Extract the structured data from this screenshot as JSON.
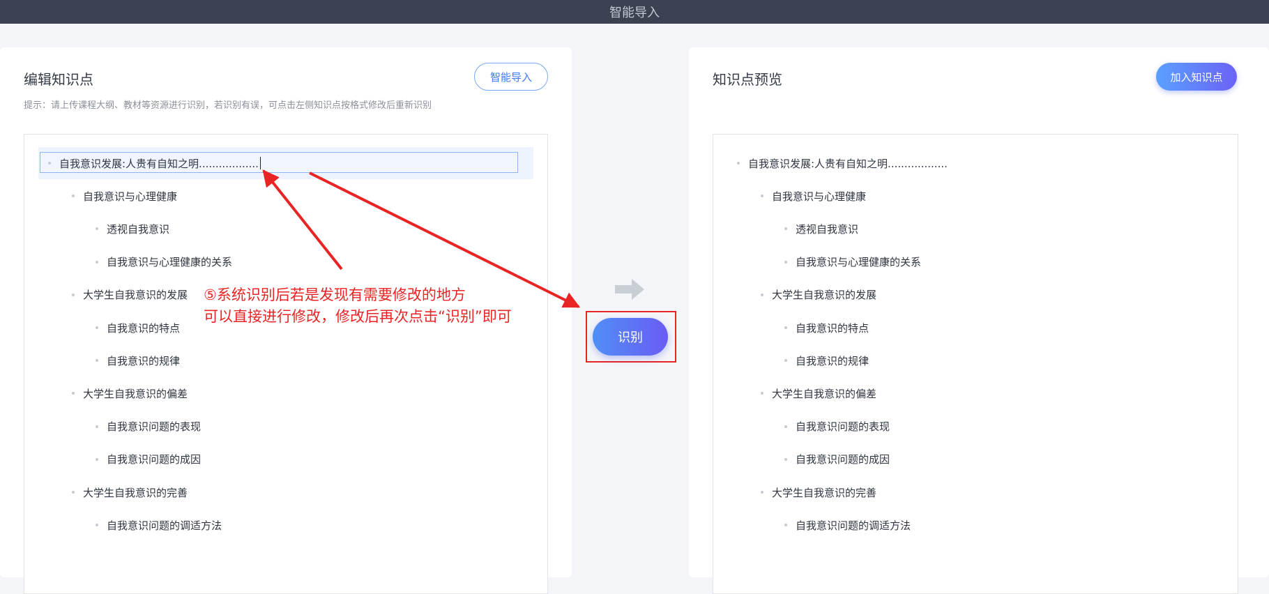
{
  "topbar": {
    "title": "智能导入"
  },
  "left_panel": {
    "title": "编辑知识点",
    "hint": "提示：请上传课程大纲、教材等资源进行识别，若识别有误，可点击左侧知识点按格式修改后重新识别",
    "import_button": "智能导入",
    "items": [
      {
        "label": "自我意识发展:人贵有自知之明..................",
        "level": 0
      },
      {
        "label": "自我意识与心理健康",
        "level": 1
      },
      {
        "label": "透视自我意识",
        "level": 2
      },
      {
        "label": "自我意识与心理健康的关系",
        "level": 2
      },
      {
        "label": "大学生自我意识的发展",
        "level": 1
      },
      {
        "label": "自我意识的特点",
        "level": 2
      },
      {
        "label": "自我意识的规律",
        "level": 2
      },
      {
        "label": "大学生自我意识的偏差",
        "level": 1
      },
      {
        "label": "自我意识问题的表现",
        "level": 2
      },
      {
        "label": "自我意识问题的成因",
        "level": 2
      },
      {
        "label": "大学生自我意识的完善",
        "level": 1
      },
      {
        "label": "自我意识问题的调适方法",
        "level": 2
      }
    ]
  },
  "middle": {
    "recognize_button": "识别"
  },
  "right_panel": {
    "title": "知识点预览",
    "add_button": "加入知识点",
    "items": [
      {
        "label": "自我意识发展:人贵有自知之明..................",
        "level": 0
      },
      {
        "label": "自我意识与心理健康",
        "level": 1
      },
      {
        "label": "透视自我意识",
        "level": 2
      },
      {
        "label": "自我意识与心理健康的关系",
        "level": 2
      },
      {
        "label": "大学生自我意识的发展",
        "level": 1
      },
      {
        "label": "自我意识的特点",
        "level": 2
      },
      {
        "label": "自我意识的规律",
        "level": 2
      },
      {
        "label": "大学生自我意识的偏差",
        "level": 1
      },
      {
        "label": "自我意识问题的表现",
        "level": 2
      },
      {
        "label": "自我意识问题的成因",
        "level": 2
      },
      {
        "label": "大学生自我意识的完善",
        "level": 1
      },
      {
        "label": "自我意识问题的调适方法",
        "level": 2
      }
    ]
  },
  "annotation": {
    "line1": "⑤系统识别后若是发现有需要修改的地方",
    "line2": "可以直接进行修改，修改后再次点击“识别”即可"
  },
  "colors": {
    "accent": "#4f8ff7",
    "annotation_red": "#e82424",
    "topbar": "#3a4150"
  },
  "icons": {
    "middle_arrow": "arrow-right-icon"
  }
}
